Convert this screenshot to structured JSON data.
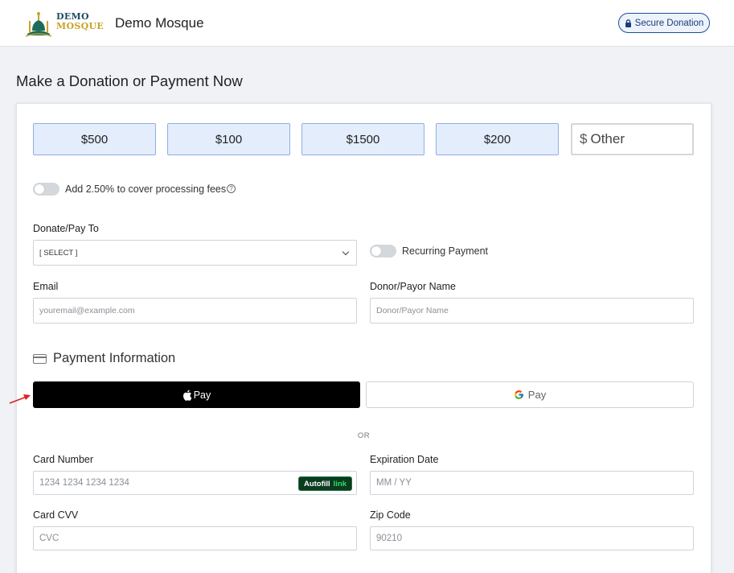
{
  "header": {
    "logo_line1": "DEMO",
    "logo_line2": "MOSQUE",
    "org_name": "Demo Mosque",
    "secure_label": "Secure Donation",
    "secure_icon": "lock-icon"
  },
  "page": {
    "title": "Make a Donation or Payment Now"
  },
  "amounts": [
    "$500",
    "$100",
    "$1500",
    "$200"
  ],
  "other_amount": {
    "currency": "$",
    "placeholder": "Other"
  },
  "fee_toggle": {
    "label": "Add 2.50% to cover processing fees",
    "on": false,
    "help_icon": "question-icon"
  },
  "donate_to": {
    "label": "Donate/Pay To",
    "value": "[ SELECT ]"
  },
  "recurring": {
    "label": "Recurring Payment",
    "on": false
  },
  "email": {
    "label": "Email",
    "placeholder": "youremail@example.com"
  },
  "donor_name": {
    "label": "Donor/Payor Name",
    "placeholder": "Donor/Payor Name"
  },
  "payment": {
    "section_title": "Payment Information",
    "apple_pay_label": "Pay",
    "google_pay_label": "Pay",
    "or_text": "OR"
  },
  "card_number": {
    "label": "Card Number",
    "placeholder": "1234 1234 1234 1234",
    "autofill_label": "Autofill",
    "autofill_link": "link"
  },
  "expiration": {
    "label": "Expiration Date",
    "placeholder": "MM / YY"
  },
  "cvv": {
    "label": "Card CVV",
    "placeholder": "CVC"
  },
  "zip": {
    "label": "Zip Code",
    "placeholder": "90210"
  },
  "colors": {
    "accent": "#1a4f9c",
    "amount_bg": "#e3edfc",
    "amount_border": "#8fb0e0",
    "autofill_green": "#33dd66"
  }
}
